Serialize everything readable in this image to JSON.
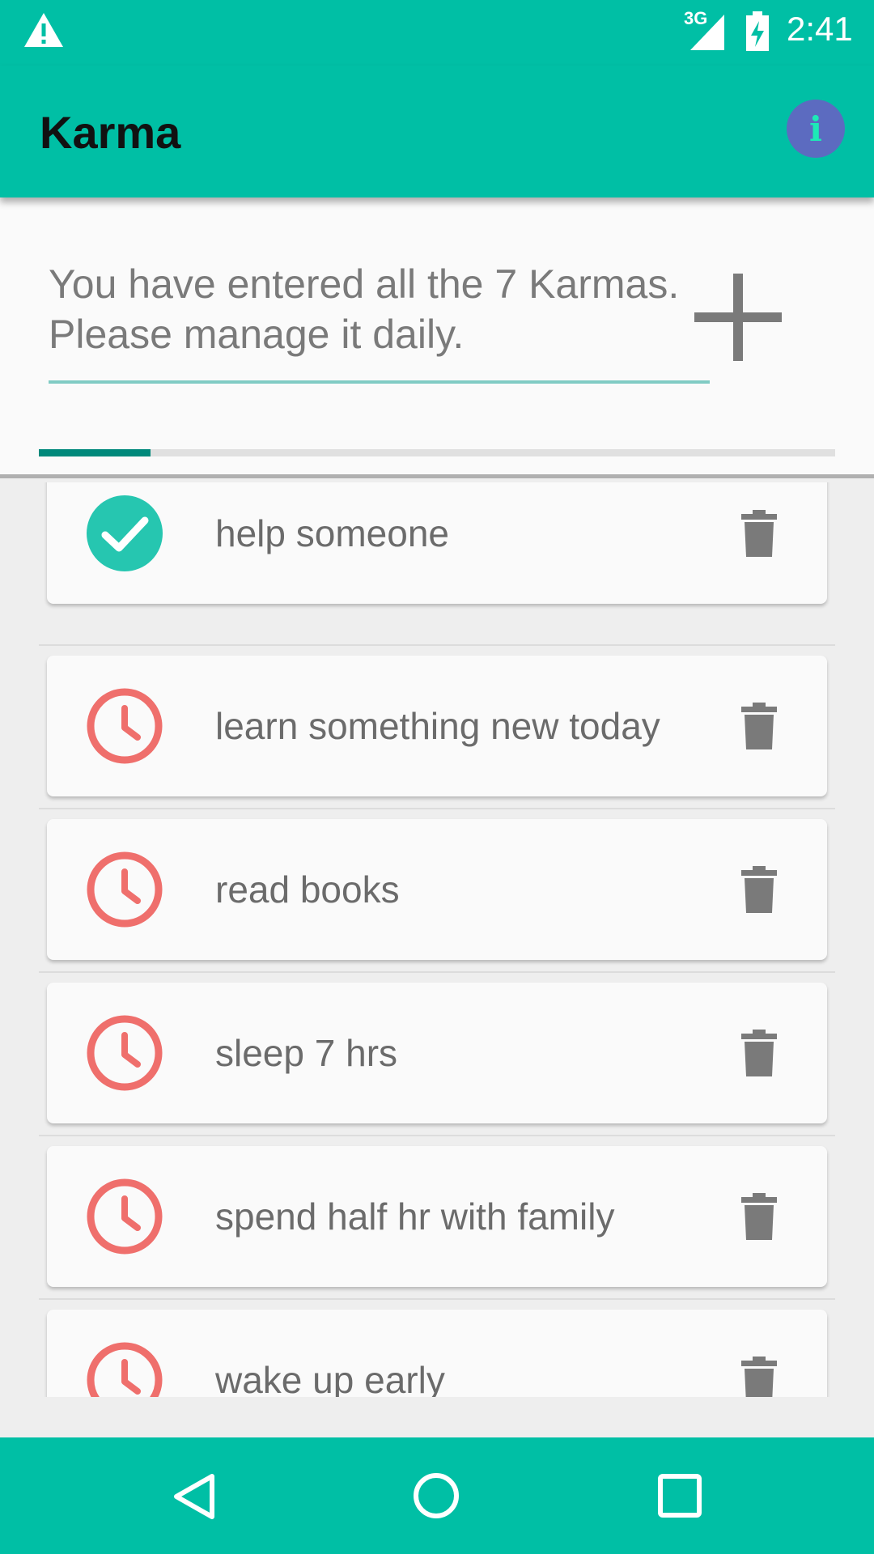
{
  "status_bar": {
    "network": "3G",
    "time": "2:41",
    "icons": [
      "warning-icon",
      "signal-icon",
      "battery-charging-icon"
    ]
  },
  "app_bar": {
    "title": "Karma",
    "info_icon": "info-icon",
    "info_glyph": "i"
  },
  "input": {
    "value": "You have entered all the 7 Karmas. Please manage it daily.",
    "add_icon": "plus-icon"
  },
  "progress": {
    "fraction": 0.14
  },
  "karmas": [
    {
      "label": "help someone",
      "status": "done",
      "status_icon": "check-circle-icon",
      "delete_icon": "trash-icon"
    },
    {
      "label": "learn something new today",
      "status": "pending",
      "status_icon": "clock-icon",
      "delete_icon": "trash-icon"
    },
    {
      "label": "read books",
      "status": "pending",
      "status_icon": "clock-icon",
      "delete_icon": "trash-icon"
    },
    {
      "label": "sleep 7 hrs",
      "status": "pending",
      "status_icon": "clock-icon",
      "delete_icon": "trash-icon"
    },
    {
      "label": "spend half hr with family",
      "status": "pending",
      "status_icon": "clock-icon",
      "delete_icon": "trash-icon"
    },
    {
      "label": "wake up early",
      "status": "pending",
      "status_icon": "clock-icon",
      "delete_icon": "trash-icon"
    }
  ],
  "nav_bar": {
    "icons": [
      "back-icon",
      "home-icon",
      "recents-icon"
    ]
  },
  "colors": {
    "primary": "#00bfa5",
    "accent": "#5c6bc0",
    "done": "#26c6b0",
    "pending": "#ef6f6c",
    "icon_gray": "#7a7a7a"
  }
}
